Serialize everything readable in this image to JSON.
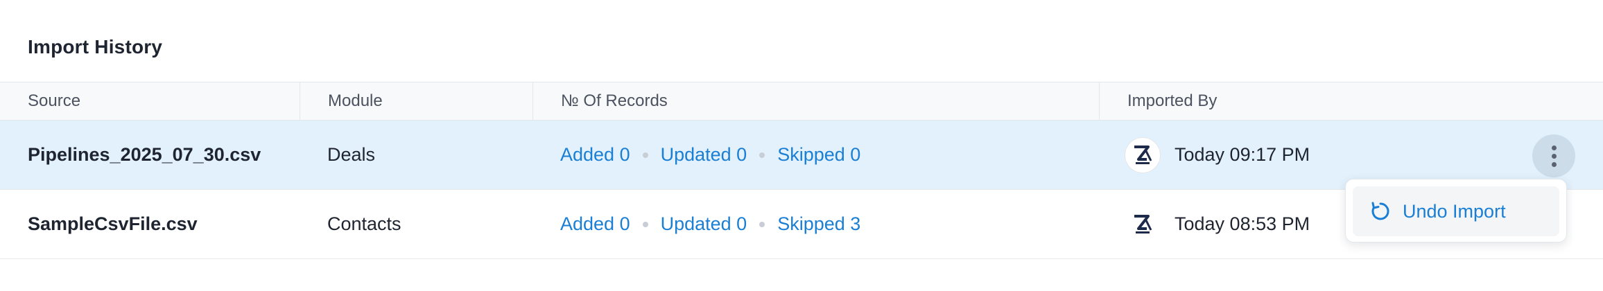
{
  "page": {
    "title": "Import History"
  },
  "table": {
    "columns": [
      "Source",
      "Module",
      "№ Of Records",
      "Imported By"
    ],
    "rows": [
      {
        "source": "Pipelines_2025_07_30.csv",
        "module": "Deals",
        "added": "Added 0",
        "updated": "Updated 0",
        "skipped": "Skipped 0",
        "time": "Today 09:17 PM",
        "selected": true
      },
      {
        "source": "SampleCsvFile.csv",
        "module": "Contacts",
        "added": "Added 0",
        "updated": "Updated 0",
        "skipped": "Skipped 3",
        "time": "Today 08:53 PM",
        "selected": false
      }
    ]
  },
  "row_menu": {
    "icon": "undo-refresh-icon",
    "undo_label": "Undo Import"
  },
  "colors": {
    "accent": "#1a7fd4",
    "selected_row": "#e2f1fb",
    "header_bg": "#f8f9fa"
  }
}
